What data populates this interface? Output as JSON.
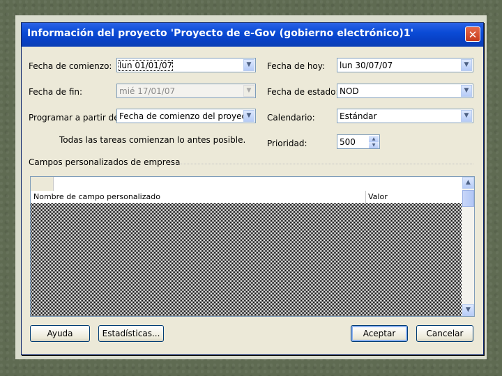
{
  "dialog": {
    "title": "Información del proyecto 'Proyecto de e-Gov (gobierno electrónico)1'",
    "close_glyph": "✕"
  },
  "form": {
    "start_date_label": "Fecha de comienzo:",
    "start_date_value": "lun 01/01/07",
    "finish_date_label": "Fecha de fin:",
    "finish_date_value": "mié 17/01/07",
    "schedule_from_label": "Programar a partir de:",
    "schedule_from_value": "Fecha de comienzo del proyecto",
    "schedule_note": "Todas las tareas comienzan lo antes posible.",
    "current_date_label": "Fecha de hoy:",
    "current_date_value": "lun 30/07/07",
    "status_date_label": "Fecha de estado:",
    "status_date_value": "NOD",
    "calendar_label": "Calendario:",
    "calendar_value": "Estándar",
    "priority_label": "Prioridad:",
    "priority_value": "500"
  },
  "custom_fields": {
    "section_label": "Campos personalizados de empresa",
    "columns": [
      "Nombre de campo personalizado",
      "Valor"
    ]
  },
  "buttons": {
    "help": "Ayuda",
    "statistics": "Estadísticas...",
    "ok": "Aceptar",
    "cancel": "Cancelar"
  },
  "icons": {
    "dropdown": "▼",
    "up": "▲",
    "down": "▼"
  }
}
